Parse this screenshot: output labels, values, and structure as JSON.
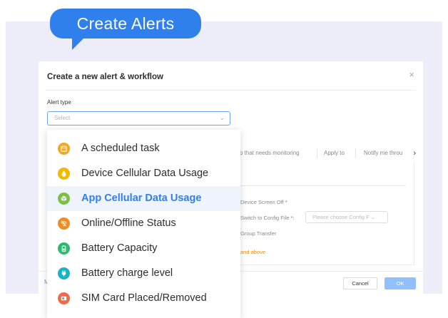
{
  "banner": {
    "title": "Create Alerts"
  },
  "dialog": {
    "title": "Create a new alert & workflow",
    "close_glyph": "×",
    "alert_type_label": "Alert type",
    "select_placeholder": "Select",
    "select_caret": "⌄",
    "tabs": [
      "p that needs monitoring",
      "Apply to",
      "Notify me throu"
    ],
    "tabs_next": "›",
    "fields": {
      "screen_off": "Device Screen Off *",
      "switch_config": "Switch to Config File *:",
      "config_placeholder": "Please choose Config F ⌄",
      "group_transfer": "Group Transfer",
      "and_above": "and above"
    },
    "footer_left": "M",
    "cancel_label": "Cancel",
    "ok_label": "OK"
  },
  "dropdown": {
    "items": [
      {
        "label": "A scheduled task",
        "icon": "calendar-icon",
        "color": "#f5a623",
        "selected": false
      },
      {
        "label": "Device Cellular Data Usage",
        "icon": "drop-icon",
        "color": "#f5b800",
        "selected": false
      },
      {
        "label": "App Cellular Data Usage",
        "icon": "cube-icon",
        "color": "#7ac143",
        "selected": true
      },
      {
        "label": "Online/Offline Status",
        "icon": "wifi-icon",
        "color": "#f58a1f",
        "selected": false
      },
      {
        "label": "Battery Capacity",
        "icon": "battery-icon",
        "color": "#2eb872",
        "selected": false
      },
      {
        "label": "Battery charge level",
        "icon": "plug-icon",
        "color": "#1ab2c4",
        "selected": false
      },
      {
        "label": "SIM Card Placed/Removed",
        "icon": "sim-card-icon",
        "color": "#f06a4a",
        "selected": false
      }
    ]
  },
  "colors": {
    "accent": "#2f80ed",
    "ok_button": "#91c0ff",
    "background_band": "#ecedf8"
  }
}
